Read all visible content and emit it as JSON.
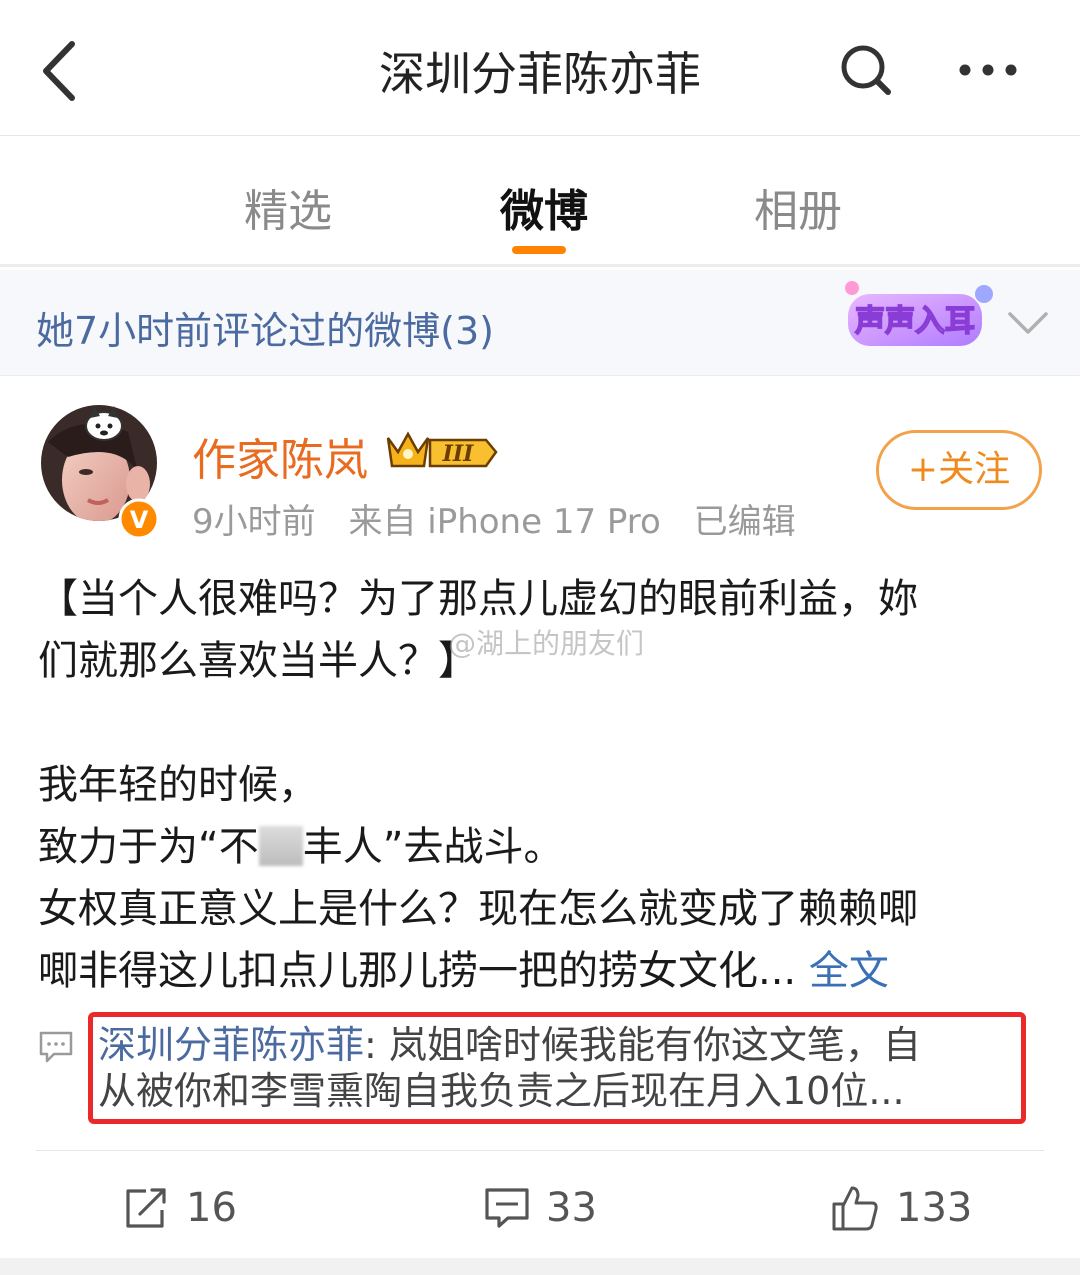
{
  "header": {
    "title": "深圳分菲陈亦菲"
  },
  "tabs": [
    {
      "label": "精选",
      "active": false
    },
    {
      "label": "微博",
      "active": true
    },
    {
      "label": "相册",
      "active": false
    }
  ],
  "history_bar": {
    "text": "她7小时前评论过的微博(3)",
    "badge_text": "声声入耳"
  },
  "post": {
    "author": "作家陈岚",
    "member_level": "III",
    "verified_badge": "V",
    "meta": {
      "time": "9小时前",
      "source": "来自 iPhone 17 Pro",
      "edited": "已编辑"
    },
    "follow_label": "+关注",
    "watermark": "@湖上的朋友们",
    "text_lines": [
      "【当个人很难吗？为了那点儿虚幻的眼前利益，妳",
      "们就那么喜欢当半人？】",
      "",
      "我年轻的时候，"
    ],
    "line_fight_before": "致力于为“不",
    "line_fight_after": "丰人”去战斗。",
    "line_q": "女权真正意义上是什么？现在怎么就变成了赖赖唧",
    "line_last": "唧非得这儿扣点儿那儿捞一把的捞女文化...",
    "full_text_link": "全文",
    "comment_preview": {
      "user": "深圳分菲陈亦菲",
      "text_line1": ": 岚姐啥时候我能有你这文笔，自",
      "text_line2": "从被你和李雪熏陶自我负责之后现在月入10位..."
    },
    "actions": {
      "reposts": "16",
      "comments": "33",
      "likes": "133"
    }
  },
  "colors": {
    "accent": "#ff8200",
    "author": "#e86b1f",
    "link": "#3b6fb6",
    "highlight_box": "#ea2a2a"
  }
}
